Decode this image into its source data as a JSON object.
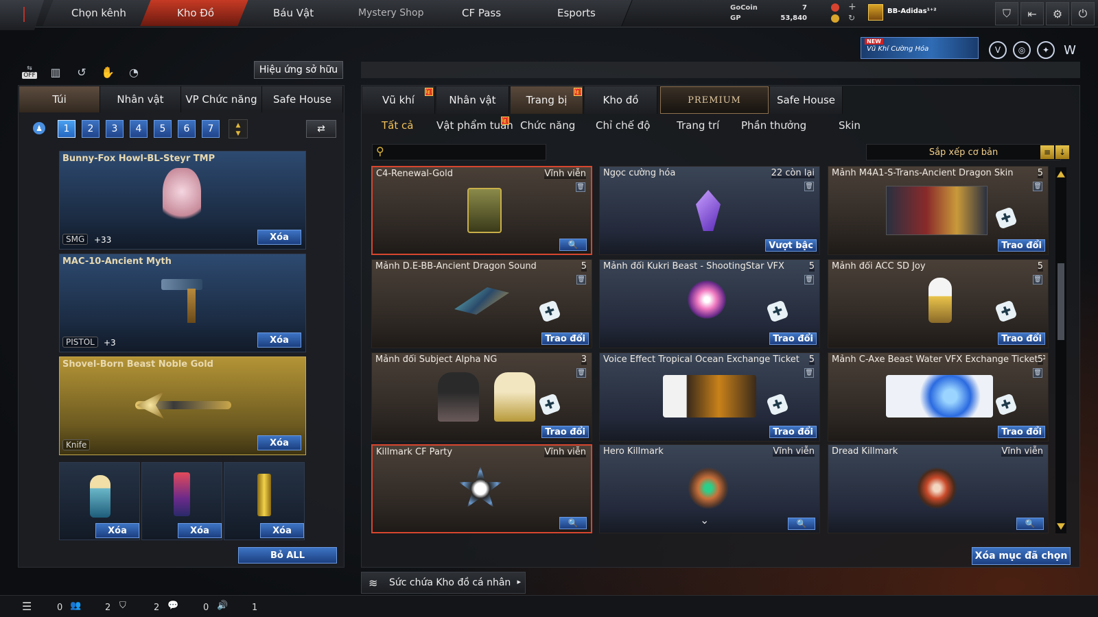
{
  "nav": {
    "tabs": [
      "Chọn kênh",
      "Kho Đồ",
      "Báu Vật",
      "Mystery Shop",
      "CF Pass",
      "Esports"
    ],
    "active": "Kho Đồ"
  },
  "currency": {
    "gocoin_label": "GoCoin",
    "gp_label": "GP",
    "gocoin_value": "7",
    "gp_value": "53,840"
  },
  "user": {
    "name": "BB-Adidas¹⁺²"
  },
  "banner": {
    "new_label": "NEW",
    "text": "Vũ Khí Cường Hóa"
  },
  "left": {
    "effect_button": "Hiệu ứng sở hữu",
    "off_label": "OFF",
    "tabs": [
      "Túi",
      "Nhân vật",
      "VP Chức năng",
      "Safe House"
    ],
    "pages": [
      "1",
      "2",
      "3",
      "4",
      "5",
      "6",
      "7"
    ],
    "slots": [
      {
        "name": "Bunny-Fox Howl-BL-Steyr TMP",
        "tag": "SMG",
        "plus": "+33",
        "delete": "Xóa"
      },
      {
        "name": "MAC-10-Ancient Myth",
        "tag": "PISTOL",
        "plus": "+3",
        "delete": "Xóa"
      },
      {
        "name": "Shovel-Born Beast Noble Gold",
        "tag": "Knife",
        "delete": "Xóa"
      }
    ],
    "mini_slots": [
      {
        "delete": "Xóa"
      },
      {
        "delete": "Xóa"
      },
      {
        "delete": "Xóa"
      }
    ],
    "remove_all": "Bỏ ALL"
  },
  "right": {
    "tabs": [
      "Vũ khí",
      "Nhân vật",
      "Trang bị",
      "Kho đồ",
      "PREMIUM",
      "Safe House"
    ],
    "subtabs": [
      "Tất cả",
      "Vật phẩm tuần",
      "Chức năng",
      "Chỉ chế độ",
      "Trang trí",
      "Phần thưởng",
      "Skin"
    ],
    "search_placeholder": "",
    "sort_label": "Sắp xếp cơ bản",
    "items": [
      {
        "title": "C4-Renewal-Gold",
        "right": "Vĩnh viễn",
        "action": "",
        "selected": true,
        "theme": "brown"
      },
      {
        "title": "Ngọc cường hóa",
        "right": "22 còn lại",
        "action": "Vượt bậc",
        "theme": "blue"
      },
      {
        "title": "Mảnh M4A1-S-Trans-Ancient Dragon Skin",
        "right": "5",
        "action": "Trao đổi",
        "theme": "brown"
      },
      {
        "title": "Mảnh D.E-BB-Ancient Dragon Sound",
        "right": "5",
        "action": "Trao đổi",
        "theme": "brown"
      },
      {
        "title": "Mảnh đổi Kukri Beast - ShootingStar VFX",
        "right": "5",
        "action": "Trao đổi",
        "theme": "blue"
      },
      {
        "title": "Mảnh đổi ACC SD Joy",
        "right": "5",
        "action": "Trao đổi",
        "theme": "brown"
      },
      {
        "title": "Mảnh đổi Subject Alpha NG",
        "right": "3",
        "action": "Trao đổi",
        "theme": "brown"
      },
      {
        "title": "Voice Effect Tropical Ocean Exchange Ticket",
        "right": "5",
        "action": "Trao đổi",
        "theme": "blue"
      },
      {
        "title": "Mảnh C-Axe Beast Water VFX Exchange Ticket Piece",
        "right": "5",
        "action": "Trao đổi",
        "theme": "brown"
      },
      {
        "title": "Killmark CF Party",
        "right": "Vĩnh viễn",
        "action": "",
        "selected": true,
        "theme": "brown"
      },
      {
        "title": "Hero Killmark",
        "right": "Vĩnh viễn",
        "action": "",
        "theme": "blue"
      },
      {
        "title": "Dread Killmark",
        "right": "Vĩnh viễn",
        "action": "",
        "theme": "blue"
      }
    ],
    "delete_selected": "Xóa mục đã chọn",
    "storage_label": "Sức chứa Kho đồ cá nhân"
  },
  "status": {
    "values": [
      "0",
      "2",
      "2",
      "0",
      "1"
    ]
  }
}
